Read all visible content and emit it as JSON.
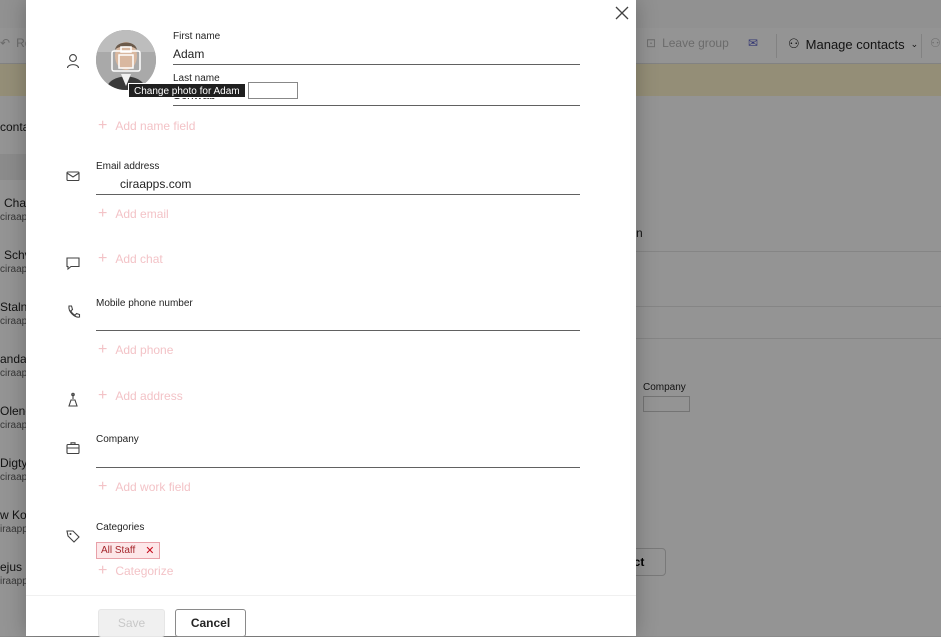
{
  "background": {
    "toolbar": {
      "leave_group": "Leave group",
      "manage_contacts": "Manage contacts",
      "left_fragment": "Ro"
    },
    "list": {
      "header": "conta",
      "rows": [
        {
          "name": "Chai",
          "mail": "ciraapp"
        },
        {
          "name": "Schv",
          "mail": "ciraapp"
        },
        {
          "name": "Staln",
          "mail": "ciraapp"
        },
        {
          "name": "andar",
          "mail": "ciraapp"
        },
        {
          "name": "Olene",
          "mail": "ciraapp"
        },
        {
          "name": "Digty",
          "mail": "ciraapp"
        },
        {
          "name": "w Ko",
          "mail": "iraapp"
        },
        {
          "name": "ejus P",
          "mail": "iraapp"
        }
      ]
    },
    "right": {
      "fragment_m": "n",
      "company_label": "Company",
      "contact_button": "act"
    }
  },
  "dialog": {
    "avatar_tooltip": "Change photo for Adam",
    "first_name": {
      "label": "First name",
      "value": "Adam"
    },
    "last_name": {
      "label": "Last name",
      "value": "Schwab"
    },
    "add_name_field": "Add name field",
    "email": {
      "label": "Email address",
      "value": "ciraapps.com"
    },
    "add_email": "Add email",
    "add_chat": "Add chat",
    "mobile": {
      "label": "Mobile phone number",
      "value": ""
    },
    "add_phone": "Add phone",
    "add_address": "Add address",
    "company": {
      "label": "Company",
      "value": ""
    },
    "add_work_field": "Add work field",
    "categories": {
      "label": "Categories",
      "tag": "All Staff",
      "tag_remove": "✕"
    },
    "categorize": "Categorize",
    "save": "Save",
    "cancel": "Cancel"
  },
  "colors": {
    "accent_add_link": "#f3c3c7",
    "tag_text": "#a4262c",
    "tag_bg": "#fde7e9"
  },
  "icons": [
    "close-icon",
    "person-icon",
    "mail-icon",
    "chat-icon",
    "phone-icon",
    "address-icon",
    "briefcase-icon",
    "tag-icon",
    "plus-icon",
    "camera-icon"
  ]
}
